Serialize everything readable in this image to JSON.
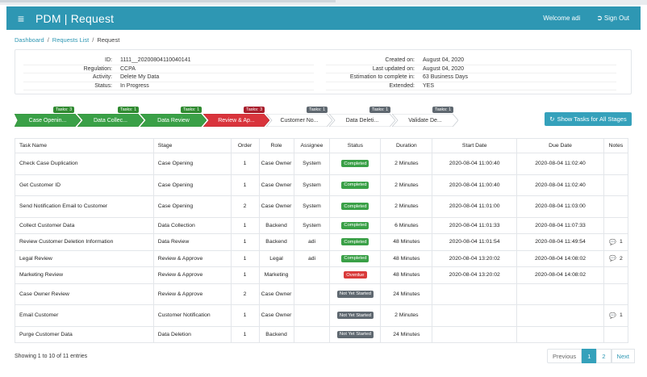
{
  "header": {
    "title": "PDM | Request",
    "welcome": "Welcome adi",
    "signout": "Sign Out",
    "menu_icon": "hamburger-icon",
    "signout_icon": "sign-out-icon"
  },
  "breadcrumb": {
    "dashboard": "Dashboard",
    "sep1": "/",
    "requests": "Requests List",
    "sep2": "/",
    "current": "Request"
  },
  "info": {
    "left": [
      {
        "label": "ID:",
        "value": "1111__20200804110040141"
      },
      {
        "label": "Regulation:",
        "value": "CCPA"
      },
      {
        "label": "Activity:",
        "value": "Delete My Data"
      },
      {
        "label": "Status:",
        "value": "In Progress"
      }
    ],
    "right": [
      {
        "label": "Created on:",
        "value": "August 04, 2020"
      },
      {
        "label": "Last updated on:",
        "value": "August 04, 2020"
      },
      {
        "label": "Estimation to complete in:",
        "value": "63 Business Days"
      },
      {
        "label": "Extended:",
        "value": "YES"
      }
    ]
  },
  "stages": [
    {
      "label": "Case Openin...",
      "tasks": "Tasks: 3",
      "state": "completed"
    },
    {
      "label": "Data Collec...",
      "tasks": "Tasks: 1",
      "state": "completed"
    },
    {
      "label": "Data Review",
      "tasks": "Tasks: 1",
      "state": "completed"
    },
    {
      "label": "Review & Ap...",
      "tasks": "Tasks: 3",
      "state": "active"
    },
    {
      "label": "Customer No...",
      "tasks": "Tasks: 1",
      "state": "pending"
    },
    {
      "label": "Data Deleti...",
      "tasks": "Tasks: 1",
      "state": "pending"
    },
    {
      "label": "Validate De...",
      "tasks": "Tasks: 1",
      "state": "pending"
    }
  ],
  "show_tasks_button": "Show Tasks for All Stages",
  "colors": {
    "header": "#2e97b3",
    "stage_completed": "#3aa047",
    "stage_active": "#d9343c",
    "status_completed": "#3aa047",
    "status_overdue": "#d93a3a",
    "status_not_started": "#5f6870"
  },
  "table": {
    "headers": [
      "Task Name",
      "Stage",
      "Order",
      "Role",
      "Assignee",
      "Status",
      "Duration",
      "Start Date",
      "Due Date",
      "Notes"
    ],
    "rows": [
      {
        "task": "Check Case Duplication",
        "stage": "Case Opening",
        "order": "1",
        "role": "Case Owner",
        "assignee": "System",
        "status": "Completed",
        "status_kind": "completed",
        "duration": "2 Minutes",
        "start": "2020-08-04 11:00:40",
        "due": "2020-08-04 11:02:40",
        "notes": ""
      },
      {
        "task": "Get Customer ID",
        "stage": "Case Opening",
        "order": "1",
        "role": "Case Owner",
        "assignee": "System",
        "status": "Completed",
        "status_kind": "completed",
        "duration": "2 Minutes",
        "start": "2020-08-04 11:00:40",
        "due": "2020-08-04 11:02:40",
        "notes": ""
      },
      {
        "task": "Send Notification Email to Customer",
        "stage": "Case Opening",
        "order": "2",
        "role": "Case Owner",
        "assignee": "System",
        "status": "Completed",
        "status_kind": "completed",
        "duration": "2 Minutes",
        "start": "2020-08-04 11:01:00",
        "due": "2020-08-04 11:03:00",
        "notes": ""
      },
      {
        "task": "Collect Customer Data",
        "stage": "Data Collection",
        "order": "1",
        "role": "Backend",
        "assignee": "System",
        "status": "Completed",
        "status_kind": "completed",
        "duration": "6 Minutes",
        "start": "2020-08-04 11:01:33",
        "due": "2020-08-04 11:07:33",
        "notes": ""
      },
      {
        "task": "Review Customer Deletion Information",
        "stage": "Data Review",
        "order": "1",
        "role": "Backend",
        "assignee": "adi",
        "status": "Completed",
        "status_kind": "completed",
        "duration": "48 Minutes",
        "start": "2020-08-04 11:01:54",
        "due": "2020-08-04 11:49:54",
        "notes": "1"
      },
      {
        "task": "Legal Review",
        "stage": "Review & Approve",
        "order": "1",
        "role": "Legal",
        "assignee": "adi",
        "status": "Completed",
        "status_kind": "completed",
        "duration": "48 Minutes",
        "start": "2020-08-04 13:20:02",
        "due": "2020-08-04 14:08:02",
        "notes": "2"
      },
      {
        "task": "Marketing Review",
        "stage": "Review & Approve",
        "order": "1",
        "role": "Marketing",
        "assignee": "",
        "status": "Overdue",
        "status_kind": "overdue",
        "duration": "48 Minutes",
        "start": "2020-08-04 13:20:02",
        "due": "2020-08-04 14:08:02",
        "notes": ""
      },
      {
        "task": "Case Owner Review",
        "stage": "Review & Approve",
        "order": "2",
        "role": "Case Owner",
        "assignee": "",
        "status": "Not Yet Started",
        "status_kind": "notstarted",
        "duration": "24 Minutes",
        "start": "",
        "due": "",
        "notes": ""
      },
      {
        "task": "Email Customer",
        "stage": "Customer Notification",
        "order": "1",
        "role": "Case Owner",
        "assignee": "",
        "status": "Not Yet Started",
        "status_kind": "notstarted",
        "duration": "2 Minutes",
        "start": "",
        "due": "",
        "notes": "1"
      },
      {
        "task": "Purge Customer Data",
        "stage": "Data Deletion",
        "order": "1",
        "role": "Backend",
        "assignee": "",
        "status": "Not Yet Started",
        "status_kind": "notstarted",
        "duration": "24 Minutes",
        "start": "",
        "due": "",
        "notes": ""
      }
    ]
  },
  "footer": {
    "showing": "Showing 1 to 10 of 11 entries",
    "previous": "Previous",
    "pages": [
      "1",
      "2"
    ],
    "current_page": "1",
    "next": "Next"
  }
}
